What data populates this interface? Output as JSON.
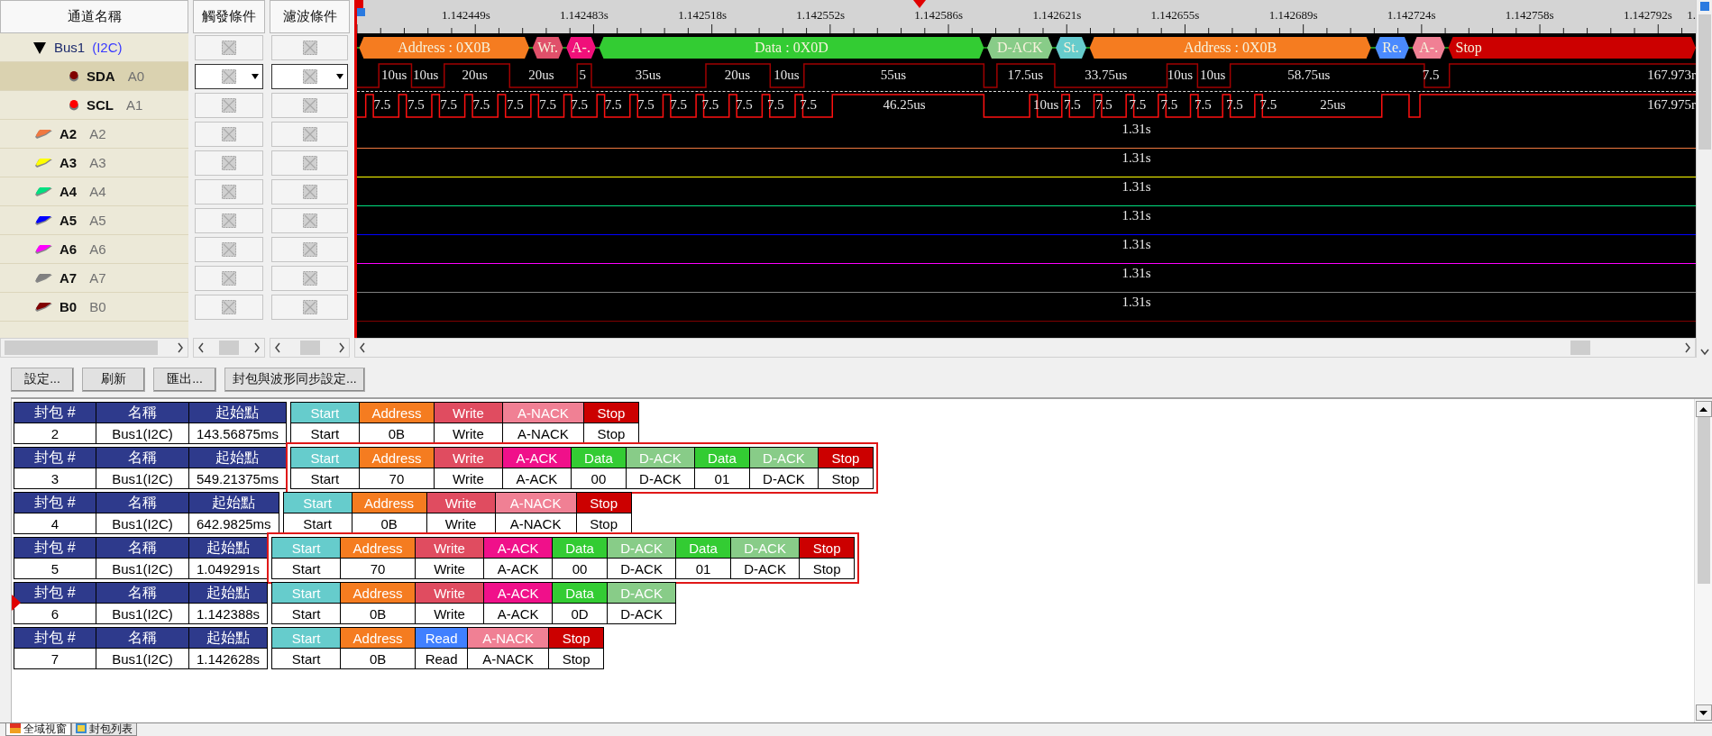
{
  "channel_panel": {
    "header": "通道名稱",
    "rows": [
      {
        "kind": "bus",
        "name": "Bus1",
        "protocol": "(I2C)",
        "expanded": true,
        "selected": false,
        "children": [
          {
            "kind": "signal",
            "name": "SDA",
            "alias": "A0",
            "color": "#800000",
            "selected": true
          },
          {
            "kind": "signal",
            "name": "SCL",
            "alias": "A1",
            "color": "#ff0000",
            "selected": false
          }
        ]
      },
      {
        "kind": "channel",
        "name": "A2",
        "alias": "A2",
        "color": "#f07840",
        "selected": false
      },
      {
        "kind": "channel",
        "name": "A3",
        "alias": "A3",
        "color": "#ffff00",
        "selected": false
      },
      {
        "kind": "channel",
        "name": "A4",
        "alias": "A4",
        "color": "#00e080",
        "selected": false
      },
      {
        "kind": "channel",
        "name": "A5",
        "alias": "A5",
        "color": "#0000ff",
        "selected": false
      },
      {
        "kind": "channel",
        "name": "A6",
        "alias": "A6",
        "color": "#ff00ff",
        "selected": false
      },
      {
        "kind": "channel",
        "name": "A7",
        "alias": "A7",
        "color": "#808080",
        "selected": false
      },
      {
        "kind": "channel",
        "name": "B0",
        "alias": "B0",
        "color": "#800000",
        "selected": false
      }
    ]
  },
  "trigger_column": {
    "header": "觸發條件"
  },
  "filter_column": {
    "header": "濾波條件"
  },
  "waveform": {
    "ruler_labels": [
      "1.142449s",
      "1.142483s",
      "1.142518s",
      "1.142552s",
      "1.142586s",
      "1.142621s",
      "1.142655s",
      "1.142689s",
      "1.142724s",
      "1.142758s",
      "1.142792s",
      "1."
    ],
    "decode_segments": [
      {
        "label": "Address : 0X0B",
        "color": "#f57c20"
      },
      {
        "label": "Wr.",
        "color": "#e0506a"
      },
      {
        "label": "A-.",
        "color": "#f0107a"
      },
      {
        "label": "Data : 0X0D",
        "color": "#33cc33"
      },
      {
        "label": "D-ACK",
        "color": "#88cc88"
      },
      {
        "label": "St.",
        "color": "#66cccc"
      },
      {
        "label": "Address : 0X0B",
        "color": "#f57c20"
      },
      {
        "label": "Re.",
        "color": "#4a8aff"
      },
      {
        "label": "A-.",
        "color": "#f08094"
      },
      {
        "label": "Stop",
        "color": "#cc0000"
      }
    ],
    "sda_labels": [
      "10us",
      "10us",
      "20us",
      "20us",
      "5",
      "35us",
      "20us",
      "10us",
      "55us",
      "17.5us",
      "33.75us",
      "10us",
      "10us",
      "58.75us",
      "7.5",
      "167.973r"
    ],
    "scl_labels": [
      "7.5",
      "7.5",
      "7.5",
      "7.5",
      "7.5",
      "7.5",
      "7.5",
      "7.5",
      "7.5",
      "7.5",
      "7.5",
      "7.5",
      "7.5",
      "7.5",
      "46.25us",
      "10us",
      "7.5",
      "7.5",
      "7.5",
      "7.5",
      "7.5",
      "7.5",
      "7.5",
      "25us",
      "167.975r"
    ],
    "traces": [
      {
        "label": "1.31s"
      },
      {
        "label": "1.31s"
      },
      {
        "label": "1.31s"
      },
      {
        "label": "1.31s"
      },
      {
        "label": "1.31s"
      },
      {
        "label": "1.31s"
      },
      {
        "label": "1.31s"
      }
    ]
  },
  "toolbar": {
    "buttons": [
      "設定...",
      "刷新",
      "匯出...",
      "封包與波形同步設定..."
    ]
  },
  "packets": [
    {
      "headers": [
        "封包 #",
        "名稱",
        "起始點"
      ],
      "number": "2",
      "name": "Bus1(I2C)",
      "start": "143.56875ms",
      "selected": false,
      "highlighted": false,
      "fields": [
        {
          "kind": "start",
          "name": "Start",
          "value": "Start"
        },
        {
          "kind": "address",
          "name": "Address",
          "value": "0B"
        },
        {
          "kind": "write",
          "name": "Write",
          "value": "Write"
        },
        {
          "kind": "a-nack",
          "name": "A-NACK",
          "value": "A-NACK"
        },
        {
          "kind": "stop",
          "name": "Stop",
          "value": "Stop"
        }
      ]
    },
    {
      "headers": [
        "封包 #",
        "名稱",
        "起始點"
      ],
      "number": "3",
      "name": "Bus1(I2C)",
      "start": "549.21375ms",
      "selected": false,
      "highlighted": true,
      "fields": [
        {
          "kind": "start",
          "name": "Start",
          "value": "Start"
        },
        {
          "kind": "address",
          "name": "Address",
          "value": "70"
        },
        {
          "kind": "write",
          "name": "Write",
          "value": "Write"
        },
        {
          "kind": "a-ack",
          "name": "A-ACK",
          "value": "A-ACK"
        },
        {
          "kind": "data",
          "name": "Data",
          "value": "00"
        },
        {
          "kind": "d-ack",
          "name": "D-ACK",
          "value": "D-ACK"
        },
        {
          "kind": "data",
          "name": "Data",
          "value": "01"
        },
        {
          "kind": "d-ack",
          "name": "D-ACK",
          "value": "D-ACK"
        },
        {
          "kind": "stop",
          "name": "Stop",
          "value": "Stop"
        }
      ]
    },
    {
      "headers": [
        "封包 #",
        "名稱",
        "起始點"
      ],
      "number": "4",
      "name": "Bus1(I2C)",
      "start": "642.9825ms",
      "selected": false,
      "highlighted": false,
      "fields": [
        {
          "kind": "start",
          "name": "Start",
          "value": "Start"
        },
        {
          "kind": "address",
          "name": "Address",
          "value": "0B"
        },
        {
          "kind": "write",
          "name": "Write",
          "value": "Write"
        },
        {
          "kind": "a-nack",
          "name": "A-NACK",
          "value": "A-NACK"
        },
        {
          "kind": "stop",
          "name": "Stop",
          "value": "Stop"
        }
      ]
    },
    {
      "headers": [
        "封包 #",
        "名稱",
        "起始點"
      ],
      "number": "5",
      "name": "Bus1(I2C)",
      "start": "1.049291s",
      "selected": false,
      "highlighted": true,
      "fields": [
        {
          "kind": "start",
          "name": "Start",
          "value": "Start"
        },
        {
          "kind": "address",
          "name": "Address",
          "value": "70"
        },
        {
          "kind": "write",
          "name": "Write",
          "value": "Write"
        },
        {
          "kind": "a-ack",
          "name": "A-ACK",
          "value": "A-ACK"
        },
        {
          "kind": "data",
          "name": "Data",
          "value": "00"
        },
        {
          "kind": "d-ack",
          "name": "D-ACK",
          "value": "D-ACK"
        },
        {
          "kind": "data",
          "name": "Data",
          "value": "01"
        },
        {
          "kind": "d-ack",
          "name": "D-ACK",
          "value": "D-ACK"
        },
        {
          "kind": "stop",
          "name": "Stop",
          "value": "Stop"
        }
      ]
    },
    {
      "headers": [
        "封包 #",
        "名稱",
        "起始點"
      ],
      "number": "6",
      "name": "Bus1(I2C)",
      "start": "1.142388s",
      "selected": true,
      "highlighted": false,
      "fields": [
        {
          "kind": "start",
          "name": "Start",
          "value": "Start"
        },
        {
          "kind": "address",
          "name": "Address",
          "value": "0B"
        },
        {
          "kind": "write",
          "name": "Write",
          "value": "Write"
        },
        {
          "kind": "a-ack",
          "name": "A-ACK",
          "value": "A-ACK"
        },
        {
          "kind": "data",
          "name": "Data",
          "value": "0D"
        },
        {
          "kind": "d-ack",
          "name": "D-ACK",
          "value": "D-ACK"
        }
      ]
    },
    {
      "headers": [
        "封包 #",
        "名稱",
        "起始點"
      ],
      "number": "7",
      "name": "Bus1(I2C)",
      "start": "1.142628s",
      "selected": false,
      "highlighted": false,
      "fields": [
        {
          "kind": "start",
          "name": "Start",
          "value": "Start"
        },
        {
          "kind": "address",
          "name": "Address",
          "value": "0B"
        },
        {
          "kind": "read",
          "name": "Read",
          "value": "Read"
        },
        {
          "kind": "a-nack",
          "name": "A-NACK",
          "value": "A-NACK"
        },
        {
          "kind": "stop",
          "name": "Stop",
          "value": "Stop"
        }
      ]
    }
  ],
  "bottom_tabs": [
    {
      "label": "全域視窗",
      "selected": true
    },
    {
      "label": "封包列表",
      "selected": false
    }
  ]
}
